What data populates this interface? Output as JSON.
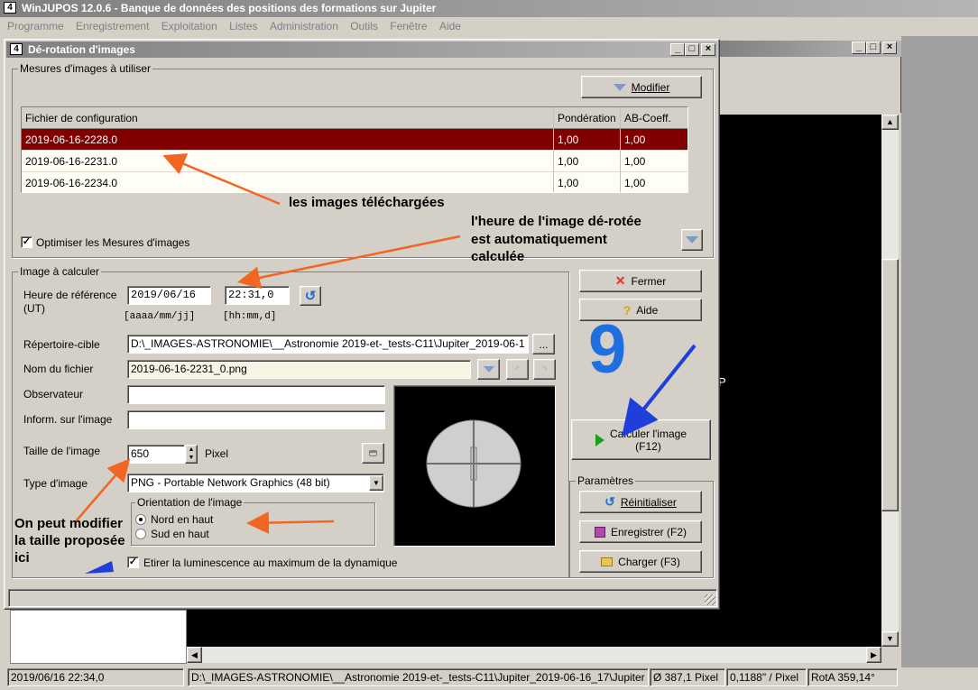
{
  "app": {
    "title": "WinJUPOS 12.0.6 - Banque de données des positions des formations sur Jupiter",
    "menu": [
      "Programme",
      "Enregistrement",
      "Exploitation",
      "Listes",
      "Administration",
      "Outils",
      "Fenêtre",
      "Aide"
    ]
  },
  "dialog": {
    "title": "Dé-rotation d'images",
    "measures_group": "Mesures d'images à utiliser",
    "modify_button": "Modifier",
    "columns": [
      "Fichier de configuration",
      "Pondération",
      "AB-Coeff."
    ],
    "rows": [
      {
        "file": "2019-06-16-2228.0",
        "weight": "1,00",
        "ab": "1,00"
      },
      {
        "file": "2019-06-16-2231.0",
        "weight": "1,00",
        "ab": "1,00"
      },
      {
        "file": "2019-06-16-2234.0",
        "weight": "1,00",
        "ab": "1,00"
      }
    ],
    "optimize_label": "Optimiser les Mesures d'images",
    "image_group": "Image à calculer",
    "ref_time_label": "Heure de référence",
    "ref_time_unit": "(UT)",
    "date_value": "2019/06/16",
    "time_value": "22:31,0",
    "date_hint": "[aaaa/mm/jj]",
    "time_hint": "[hh:mm,d]",
    "target_dir_label": "Répertoire-cible",
    "target_dir_value": "D:\\_IMAGES-ASTRONOMIE\\__Astronomie 2019-et-_tests-C11\\Jupiter_2019-06-1",
    "browse_label": "...",
    "filename_label": "Nom du fichier",
    "filename_value": "2019-06-16-2231_0.png",
    "observer_label": "Observateur",
    "observer_value": "",
    "info_label": "Inform. sur l'image",
    "info_value": "",
    "size_label": "Taille de l'image",
    "size_value": "650",
    "size_unit": "Pixel",
    "type_label": "Type d'image",
    "type_value": "PNG  - Portable Network Graphics (48 bit)",
    "orientation_group": "Orientation de l'image",
    "north_up": "Nord en haut",
    "south_up": "Sud en haut",
    "stretch_label": "Etirer la luminescence au maximum de la dynamique",
    "close_button": "Fermer",
    "help_button": "Aide",
    "compute_button": "Calculer l'image",
    "compute_shortcut": "(F12)",
    "params_group": "Paramètres",
    "reset_button": "Réinitialiser",
    "save_button": "Enregistrer (F2)",
    "load_button": "Charger (F3)"
  },
  "annotations": {
    "images": "les images téléchargées",
    "time_line1": "l'heure de l'image dé-rotée",
    "time_line2": "est automatiquement",
    "time_line3": "calculée",
    "step_number": "9",
    "size_line1": "On peut modifier",
    "size_line2": "la taille proposée",
    "size_line3": "ici"
  },
  "background": {
    "p_letter": "P"
  },
  "status": {
    "datetime": "2019/06/16   22:34,0",
    "path": "D:\\_IMAGES-ASTRONOMIE\\__Astronomie 2019-et-_tests-C11\\Jupiter_2019-06-16_17\\Jupiter",
    "diameter": "Ø 387,1 Pixel",
    "scale": "0,1188\" / Pixel",
    "rotation": "RotA 359,14°"
  },
  "colors": {
    "selected_row": "#800000",
    "annotation_orange": "#f26522",
    "annotation_blue": "#1e3fdc",
    "step_number": "#1f6fe0"
  }
}
